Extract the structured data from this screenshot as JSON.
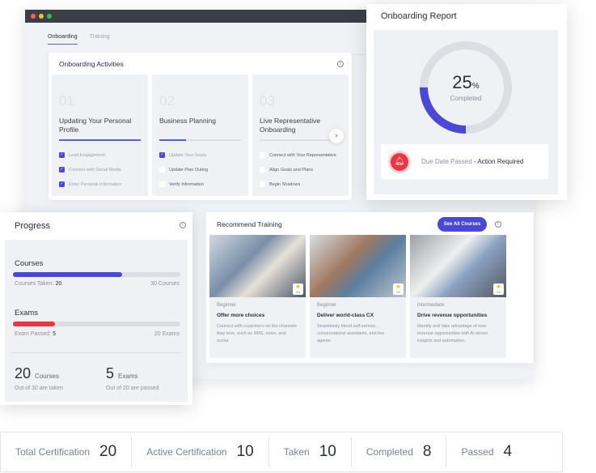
{
  "tabs": [
    "Onboarding",
    "Training"
  ],
  "activities": {
    "title": "Onboarding Activities",
    "steps": [
      {
        "num": "01",
        "title": "Updating Your Personal Profile",
        "progress": 100,
        "items": [
          {
            "label": "Lead Engagement",
            "checked": true
          },
          {
            "label": "Connect with Social Media",
            "checked": true
          },
          {
            "label": "Enter Personal Information",
            "checked": true
          }
        ]
      },
      {
        "num": "02",
        "title": "Business Planning",
        "progress": 33,
        "items": [
          {
            "label": "Update Your Goals",
            "checked": true
          },
          {
            "label": "Update Plan Outing",
            "checked": false
          },
          {
            "label": "Verify Information",
            "checked": false
          }
        ]
      },
      {
        "num": "03",
        "title": "Live Representative Onboarding",
        "progress": 0,
        "items": [
          {
            "label": "Connect with Your Representative",
            "checked": false
          },
          {
            "label": "Align Goals and Plans",
            "checked": false
          },
          {
            "label": "Begin Shadows",
            "checked": false
          }
        ]
      }
    ]
  },
  "report": {
    "title": "Onboarding Report",
    "percent": "25",
    "percent_sign": "%",
    "completed_label": "Completed",
    "alert_text": "Due Date Passed",
    "alert_action": "- Action Required",
    "alert_icon": "bell-icon"
  },
  "progress": {
    "title": "Progress",
    "courses_label": "Courses",
    "courses_taken_label": "Courses Taken:",
    "courses_taken": "20",
    "courses_total": "30 Courses",
    "courses_pct": 65,
    "exams_label": "Exams",
    "exams_passed_label": "Exam Passed:",
    "exams_passed": "5",
    "exams_total": "20 Exams",
    "exams_pct": 25,
    "summary_courses_num": "20",
    "summary_courses_unit": "Courses",
    "summary_courses_sub": "Out of 30 are taken",
    "summary_exams_num": "5",
    "summary_exams_unit": "Exams",
    "summary_exams_sub": "Out of 20 are passed"
  },
  "training": {
    "title": "Recommend Training",
    "see_all": "See All Courses",
    "courses": [
      {
        "level": "Beginner",
        "title": "Offer more choices",
        "desc": "Connect with customers on the channels they love, such as SMS, voice, and social.",
        "rating": "5/5"
      },
      {
        "level": "Beginner",
        "title": "Deliver world-class CX",
        "desc": "Seamlessly blend self-service, conversational assistants, and live agents.",
        "rating": "5/5"
      },
      {
        "level": "Intermediate",
        "title": "Drive revenue opportunities",
        "desc": "Identify and take advantage of new revenue opportunities with AI-driven insights and automation.",
        "rating": "5/5"
      }
    ]
  },
  "stats": [
    {
      "label": "Total Certification",
      "value": "20"
    },
    {
      "label": "Active Certification",
      "value": "10"
    },
    {
      "label": "Taken",
      "value": "10"
    },
    {
      "label": "Completed",
      "value": "8"
    },
    {
      "label": "Passed",
      "value": "4"
    }
  ],
  "colors": {
    "accent": "#4b48d8",
    "danger": "#ef3340"
  }
}
